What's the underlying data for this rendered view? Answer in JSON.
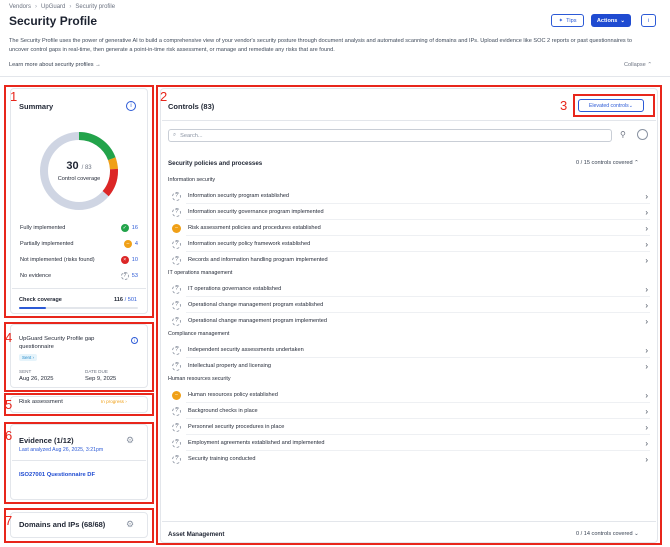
{
  "breadcrumb": [
    "Vendors",
    "UpGuard",
    "Security profile"
  ],
  "page_title": "Security Profile",
  "header_buttons": {
    "tips": "Tips",
    "actions": "Actions",
    "info": "i"
  },
  "description": "The Security Profile uses the power of generative AI to build a comprehensive view of your vendor's security posture through document analysis and automated scanning of domains and IPs. Upload evidence like SOC 2 reports or past questionnaires to uncover control gaps in real-time, then generate a point-in-time risk assessment, or manage and remediate any risks that are found.",
  "learn_more": "Learn more about security profiles",
  "collapse": "Collapse",
  "annotations": [
    "1",
    "2",
    "3",
    "4",
    "5",
    "6",
    "7"
  ],
  "summary": {
    "title": "Summary",
    "coverage_value": "30",
    "coverage_total": "/ 83",
    "coverage_label": "Control coverage",
    "rows": [
      {
        "label": "Fully implemented",
        "value": "16",
        "color": "#22a34a"
      },
      {
        "label": "Partially implemented",
        "value": "4",
        "color": "#f0a017"
      },
      {
        "label": "Not implemented (risks found)",
        "value": "10",
        "color": "#dc2626"
      },
      {
        "label": "No evidence",
        "value": "53",
        "color": "#c9ced6"
      }
    ],
    "check_coverage_label": "Check coverage",
    "check_coverage_value": "116",
    "check_coverage_total": "/ 501",
    "check_coverage_fraction": 0.23
  },
  "questionnaire": {
    "title": "UpGuard Security Profile gap questionnaire",
    "badge": "Sent",
    "sent_label": "SENT",
    "sent_date": "Aug 26, 2025",
    "due_label": "DATE DUE",
    "due_date": "Sep 9, 2025"
  },
  "risk_assessment": {
    "label": "Risk assessment",
    "status": "In progress"
  },
  "evidence": {
    "title": "Evidence (1/12)",
    "last_analyzed": "Last analyzed Aug 26, 2025, 3:21pm",
    "item": "ISO27001 Questionnaire DF"
  },
  "domains": {
    "title": "Domains and IPs (68/68)"
  },
  "controls": {
    "title": "Controls (83)",
    "elevated_button": "Elevated controls",
    "search_placeholder": "Search...",
    "sections": [
      {
        "title": "Security policies and processes",
        "covered": "0 / 15 controls covered",
        "groups": [
          {
            "name": "Information security",
            "items": [
              {
                "label": "Information security program established",
                "status": "none"
              },
              {
                "label": "Information security governance program implemented",
                "status": "none"
              },
              {
                "label": "Risk assessment policies and procedures established",
                "status": "partial"
              },
              {
                "label": "Information security policy framework established",
                "status": "none"
              },
              {
                "label": "Records and information handling program implemented",
                "status": "none"
              }
            ]
          },
          {
            "name": "IT operations management",
            "items": [
              {
                "label": "IT operations governance established",
                "status": "none"
              },
              {
                "label": "Operational change management program established",
                "status": "none"
              },
              {
                "label": "Operational change management program implemented",
                "status": "none"
              }
            ]
          },
          {
            "name": "Compliance management",
            "items": [
              {
                "label": "Independent security assessments undertaken",
                "status": "none"
              },
              {
                "label": "Intellectual property and licensing",
                "status": "none"
              }
            ]
          },
          {
            "name": "Human resources security",
            "items": [
              {
                "label": "Human resources policy established",
                "status": "partial"
              },
              {
                "label": "Background checks in place",
                "status": "none"
              },
              {
                "label": "Personnel security procedures in place",
                "status": "none"
              },
              {
                "label": "Employment agreements established and implemented",
                "status": "none"
              },
              {
                "label": "Security training conducted",
                "status": "none"
              }
            ]
          }
        ]
      },
      {
        "title": "Asset Management",
        "covered": "0 / 14 controls covered"
      }
    ]
  }
}
